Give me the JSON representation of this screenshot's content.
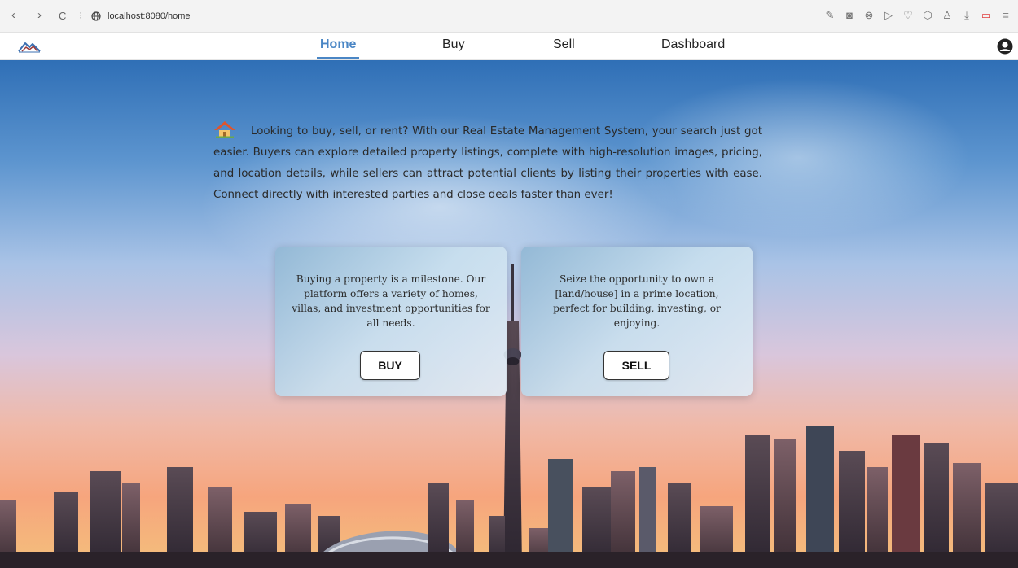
{
  "browser": {
    "url": "localhost:8080/home",
    "nav": {
      "back": "‹",
      "forward": "›",
      "reload": "C"
    }
  },
  "navbar": {
    "tabs": [
      {
        "label": "Home",
        "active": true
      },
      {
        "label": "Buy",
        "active": false
      },
      {
        "label": "Sell",
        "active": false
      },
      {
        "label": "Dashboard",
        "active": false
      }
    ],
    "accent_color": "#4a86c5"
  },
  "hero": {
    "intro_text": "Looking to buy, sell, or rent? With our Real Estate Management System, your search just got easier. Buyers can explore detailed property listings, complete with high-resolution images, pricing, and location details, while sellers can attract potential clients by listing their properties with ease. Connect directly with interested parties and close deals faster than ever!",
    "cards": [
      {
        "text": "Buying a property is a milestone. Our platform offers a variety of homes, villas, and investment opportunities for all needs.",
        "button": "BUY"
      },
      {
        "text": "Seize the opportunity to own a [land/house] in a prime location, perfect for building, investing, or enjoying.",
        "button": "SELL"
      }
    ]
  }
}
